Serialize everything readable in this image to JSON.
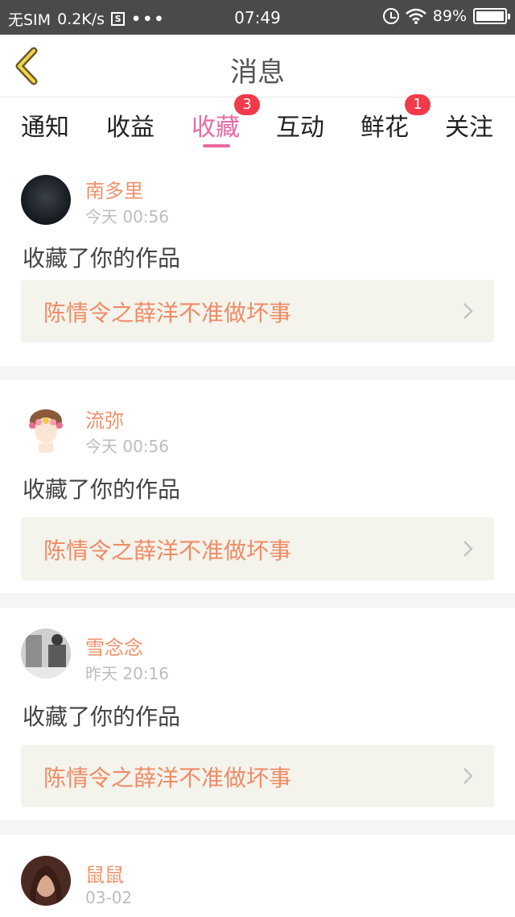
{
  "status_bar": {
    "carrier": "无SIM",
    "speed": "0.2K/s",
    "s_icon_label": "S",
    "dots": "•••",
    "time": "07:49",
    "battery": "89%"
  },
  "nav": {
    "title": "消息"
  },
  "tabs": [
    {
      "label": "通知",
      "badge": ""
    },
    {
      "label": "收益",
      "badge": ""
    },
    {
      "label": "收藏",
      "badge": "3"
    },
    {
      "label": "互动",
      "badge": ""
    },
    {
      "label": "鲜花",
      "badge": "1"
    },
    {
      "label": "关注",
      "badge": ""
    }
  ],
  "messages": [
    {
      "author": "南多里",
      "time": "今天 00:56",
      "action": "收藏了你的作品",
      "work": "陈情令之薛洋不准做坏事"
    },
    {
      "author": "流弥",
      "time": "今天 00:56",
      "action": "收藏了你的作品",
      "work": "陈情令之薛洋不准做坏事"
    },
    {
      "author": "雪念念",
      "time": "昨天 20:16",
      "action": "收藏了你的作品",
      "work": "陈情令之薛洋不准做坏事"
    },
    {
      "author": "鼠鼠",
      "time": "03-02",
      "action": "",
      "work": ""
    }
  ],
  "colors": {
    "accent": "#e86aa4",
    "badge": "#f23a4b",
    "author": "#f0906a",
    "work_title": "#ee8c66",
    "work_bg": "#f4f3ec"
  }
}
